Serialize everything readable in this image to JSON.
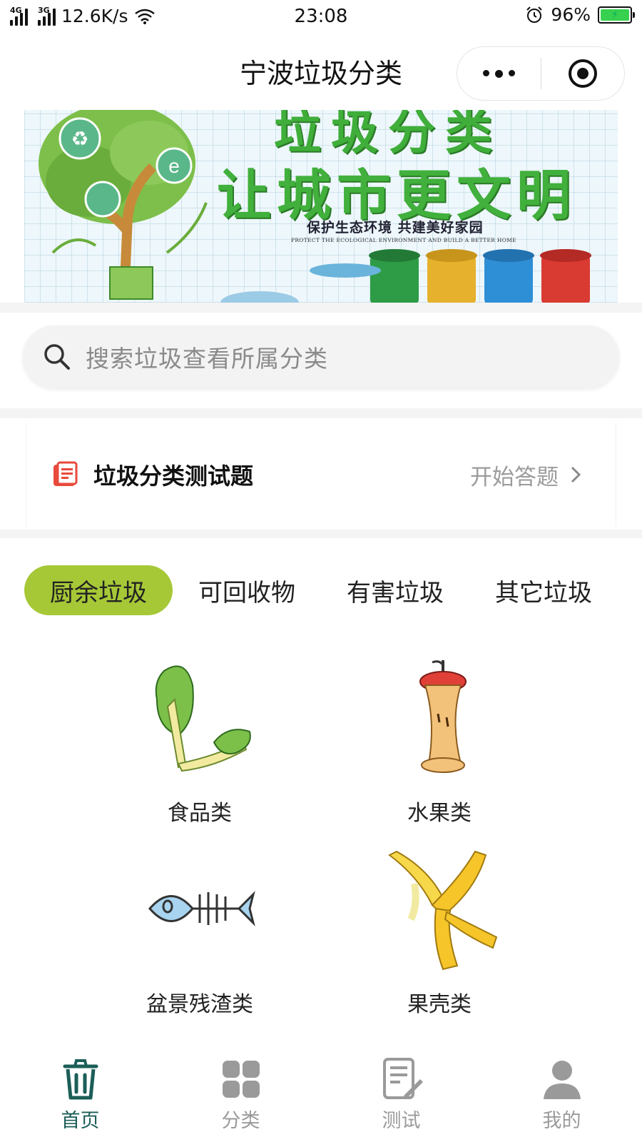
{
  "status_bar": {
    "network1": "4G",
    "network2": "3G",
    "speed": "12.6K/s",
    "time": "23:08",
    "battery": "96%"
  },
  "nav": {
    "title": "宁波垃圾分类"
  },
  "banner": {
    "line1": "垃圾分类",
    "line2": "让城市更文明",
    "line3": "保护生态环境 共建美好家园",
    "line4": "PROTECT THE ECOLOGICAL ENVIRONMENT AND BUILD A BETTER HOME"
  },
  "search": {
    "placeholder": "搜索垃圾查看所属分类"
  },
  "quiz": {
    "title": "垃圾分类测试题",
    "action": "开始答题"
  },
  "tabs": [
    {
      "label": "厨余垃圾",
      "active": true
    },
    {
      "label": "可回收物",
      "active": false
    },
    {
      "label": "有害垃圾",
      "active": false
    },
    {
      "label": "其它垃圾",
      "active": false
    }
  ],
  "items": [
    {
      "label": "食品类",
      "icon": "vegetable-leaf-icon"
    },
    {
      "label": "水果类",
      "icon": "apple-core-icon"
    },
    {
      "label": "盆景残渣类",
      "icon": "fish-bone-icon"
    },
    {
      "label": "果壳类",
      "icon": "banana-peel-icon"
    }
  ],
  "tabbar": [
    {
      "label": "首页",
      "icon": "trash-can-icon",
      "active": true
    },
    {
      "label": "分类",
      "icon": "grid-icon",
      "active": false
    },
    {
      "label": "测试",
      "icon": "edit-document-icon",
      "active": false
    },
    {
      "label": "我的",
      "icon": "user-icon",
      "active": false
    }
  ],
  "colors": {
    "accent": "#a6c837",
    "tabbar_active": "#1b5e57",
    "quiz_icon": "#e84a3c"
  }
}
